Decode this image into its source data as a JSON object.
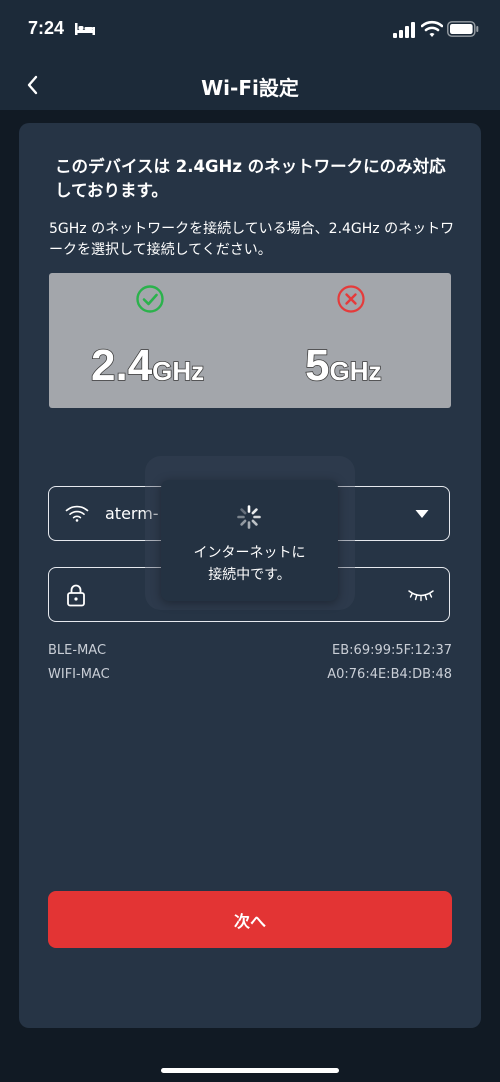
{
  "status_bar": {
    "time": "7:24",
    "icons": [
      "bed-icon",
      "signal-icon",
      "wifi-icon",
      "battery-icon"
    ]
  },
  "nav": {
    "title": "Wi-Fi設定",
    "back_icon": "chevron-left-icon"
  },
  "notice": {
    "headline": "このデバイスは 2.4GHz のネットワークにのみ対応しております。",
    "subtext": "5GHz のネットワークを接続している場合、2.4GHz のネットワークを選択して接続してください。"
  },
  "frequency_panel": {
    "supported": {
      "number": "2.4",
      "unit": "GHz",
      "status_icon": "check-circle-icon"
    },
    "unsupported": {
      "number": "5",
      "unit": "GHz",
      "status_icon": "x-circle-icon"
    }
  },
  "ssid_field": {
    "value": "aterm-",
    "icon": "wifi-icon",
    "dropdown_icon": "triangle-down-icon"
  },
  "password_field": {
    "value": "",
    "icon": "lock-icon",
    "toggle_icon": "eye-closed-icon"
  },
  "mac_info": {
    "ble_label": "BLE-MAC",
    "ble_value": "EB:69:99:5F:12:37",
    "wifi_label": "WIFI-MAC",
    "wifi_value": "A0:76:4E:B4:DB:48"
  },
  "loading": {
    "line1": "インターネットに",
    "line2": "接続中です。"
  },
  "next_button": {
    "label": "次へ"
  },
  "colors": {
    "background": "#111a24",
    "card": "#263445",
    "accent_red": "#e33434",
    "check_green": "#2bb24c",
    "cross_red": "#e53b3b"
  }
}
